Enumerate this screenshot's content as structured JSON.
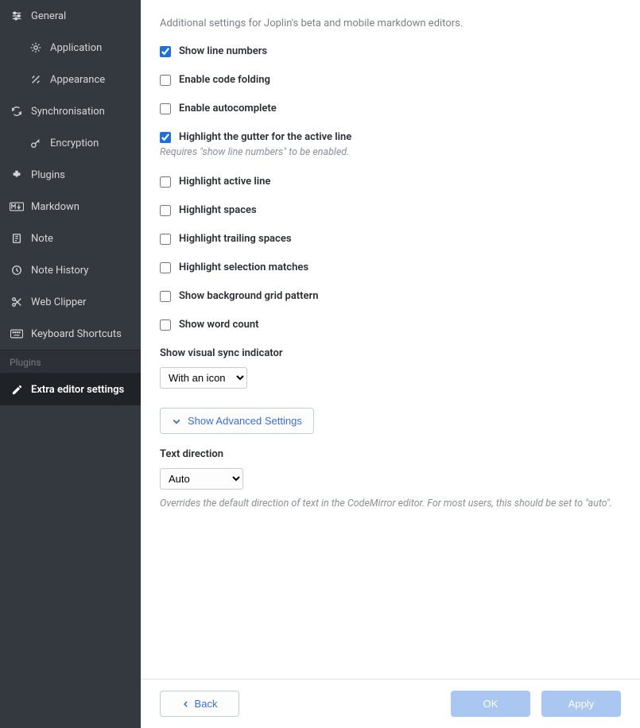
{
  "sidebar": {
    "items": [
      {
        "label": "General",
        "icon": "sliders-icon",
        "indent": false
      },
      {
        "label": "Application",
        "icon": "gear-icon",
        "indent": true
      },
      {
        "label": "Appearance",
        "icon": "tools-icon",
        "indent": true
      },
      {
        "label": "Synchronisation",
        "icon": "sync-icon",
        "indent": false
      },
      {
        "label": "Encryption",
        "icon": "key-icon",
        "indent": true
      },
      {
        "label": "Plugins",
        "icon": "plug-icon",
        "indent": false
      },
      {
        "label": "Markdown",
        "icon": "markdown-icon",
        "indent": false
      },
      {
        "label": "Note",
        "icon": "note-icon",
        "indent": false
      },
      {
        "label": "Note History",
        "icon": "history-icon",
        "indent": false
      },
      {
        "label": "Web Clipper",
        "icon": "scissors-icon",
        "indent": false
      },
      {
        "label": "Keyboard Shortcuts",
        "icon": "keyboard-icon",
        "indent": false
      }
    ],
    "pluginsSectionLabel": "Plugins",
    "pluginItem": {
      "label": "Extra editor settings",
      "icon": "edit-icon"
    }
  },
  "main": {
    "description": "Additional settings for Joplin's beta and mobile markdown editors.",
    "checkboxes": [
      {
        "key": "lineNumbers",
        "label": "Show line numbers",
        "checked": true,
        "help": null
      },
      {
        "key": "codeFolding",
        "label": "Enable code folding",
        "checked": false,
        "help": null
      },
      {
        "key": "autocomplete",
        "label": "Enable autocomplete",
        "checked": false,
        "help": null
      },
      {
        "key": "gutterActive",
        "label": "Highlight the gutter for the active line",
        "checked": true,
        "help": "Requires \"show line numbers\" to be enabled."
      },
      {
        "key": "activeLine",
        "label": "Highlight active line",
        "checked": false,
        "help": null
      },
      {
        "key": "spaces",
        "label": "Highlight spaces",
        "checked": false,
        "help": null
      },
      {
        "key": "trailingSpaces",
        "label": "Highlight trailing spaces",
        "checked": false,
        "help": null
      },
      {
        "key": "selectionMatches",
        "label": "Highlight selection matches",
        "checked": false,
        "help": null
      },
      {
        "key": "bgGrid",
        "label": "Show background grid pattern",
        "checked": false,
        "help": null
      },
      {
        "key": "wordCount",
        "label": "Show word count",
        "checked": false,
        "help": null
      }
    ],
    "syncIndicator": {
      "label": "Show visual sync indicator",
      "value": "With an icon"
    },
    "advancedButton": "Show Advanced Settings",
    "textDirection": {
      "label": "Text direction",
      "value": "Auto",
      "help": "Overrides the default direction of text in the CodeMirror editor. For most users, this should be set to \"auto\"."
    }
  },
  "footer": {
    "back": "Back",
    "ok": "OK",
    "apply": "Apply"
  }
}
